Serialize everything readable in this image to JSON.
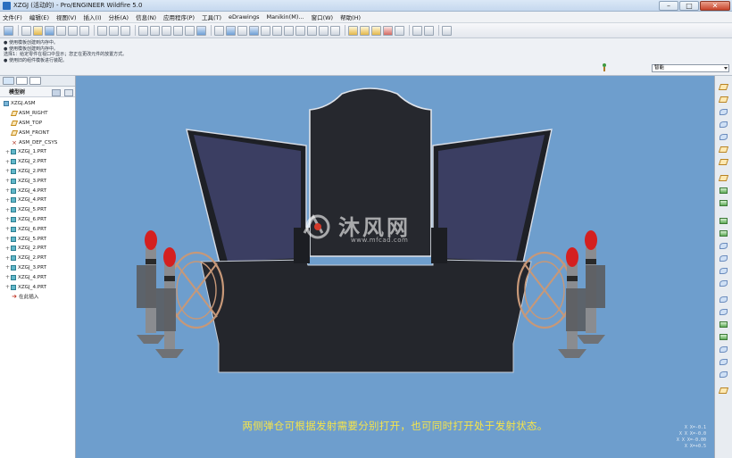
{
  "window": {
    "title": "XZGJ (活动的) - Pro/ENGINEER Wildfire 5.0",
    "minimize": "–",
    "maximize": "□",
    "close": "✕"
  },
  "menu": [
    "文件(F)",
    "编辑(E)",
    "视图(V)",
    "插入(I)",
    "分析(A)",
    "信息(N)",
    "应用程序(P)",
    "工具(T)",
    "eDrawings",
    "Manikin(M)...",
    "窗口(W)",
    "帮助(H)"
  ],
  "messages": [
    "● 使用模板创建到内存中。",
    "● 使用模板创建到内存中。",
    "  选择1：给定零件在视口中显示；您正在更改元件的放置方式。",
    "● 使用旧的组件模板进行装配。"
  ],
  "filter": {
    "value": "智能"
  },
  "navigator": {
    "header": "模型树"
  },
  "tree": [
    {
      "label": "XZGJ.ASM",
      "kind": "asm",
      "level": "root"
    },
    {
      "label": "ASM_RIGHT",
      "kind": "plane",
      "level": "child"
    },
    {
      "label": "ASM_TOP",
      "kind": "plane",
      "level": "child"
    },
    {
      "label": "ASM_FRONT",
      "kind": "plane",
      "level": "child"
    },
    {
      "label": "ASM_DEF_CSYS",
      "kind": "csys",
      "level": "child"
    },
    {
      "label": "XZGJ_1.PRT",
      "kind": "prt",
      "level": "part"
    },
    {
      "label": "XZGJ_2.PRT",
      "kind": "prt",
      "level": "part"
    },
    {
      "label": "XZGJ_2.PRT",
      "kind": "prt",
      "level": "part"
    },
    {
      "label": "XZGJ_3.PRT",
      "kind": "prt",
      "level": "part"
    },
    {
      "label": "XZGJ_4.PRT",
      "kind": "prt",
      "level": "part"
    },
    {
      "label": "XZGJ_4.PRT",
      "kind": "prt",
      "level": "part"
    },
    {
      "label": "XZGJ_5.PRT",
      "kind": "prt",
      "level": "part"
    },
    {
      "label": "XZGJ_6.PRT",
      "kind": "prt",
      "level": "part"
    },
    {
      "label": "XZGJ_6.PRT",
      "kind": "prt",
      "level": "part"
    },
    {
      "label": "XZGJ_5.PRT",
      "kind": "prt",
      "level": "part"
    },
    {
      "label": "XZGJ_2.PRT",
      "kind": "prt",
      "level": "part"
    },
    {
      "label": "XZGJ_2.PRT",
      "kind": "prt",
      "level": "part"
    },
    {
      "label": "XZGJ_3.PRT",
      "kind": "prt",
      "level": "part"
    },
    {
      "label": "XZGJ_4.PRT",
      "kind": "prt",
      "level": "part"
    },
    {
      "label": "XZGJ_4.PRT",
      "kind": "prt",
      "level": "part"
    },
    {
      "label": "在此插入",
      "kind": "insert",
      "level": "child"
    }
  ],
  "viewport": {
    "caption": "两侧弹仓可根据发射需要分别打开，也可同时打开处于发射状态。",
    "watermark": "沐风网",
    "watermark_url": "www.mfcad.com",
    "coords": [
      "X X=-0.1",
      "X X X=-0.0",
      "X X X=-0.00",
      "X X=+0.5"
    ],
    "colors": {
      "background": "#6e9ecd",
      "hull": "#23252b",
      "panel": "#3e4163",
      "missile_tip": "#d42020",
      "rail": "#c79878"
    }
  }
}
